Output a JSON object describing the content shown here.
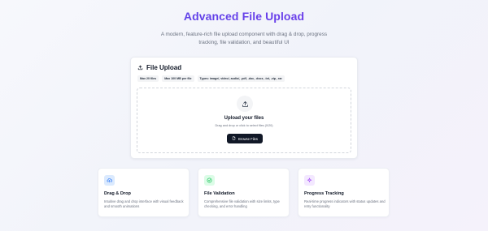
{
  "hero": {
    "title": "Advanced File Upload",
    "subtitle": "A modern, feature-rich file upload component with drag & drop, progress tracking, file validation, and beautiful UI"
  },
  "upload_card": {
    "title": "File Upload",
    "title_icon": "upload-icon",
    "badges": [
      "Max 20 files",
      "Max 100 MB per file",
      "Types: image/, video/, audio/, .pdf, .doc, .docx, .txt, .zip, .rar"
    ],
    "dropzone": {
      "icon": "upload-icon",
      "title": "Upload your files",
      "subtitle": "Drag and drop or click to select files (0/20)",
      "button_label": "Browse Files",
      "button_icon": "file-icon"
    }
  },
  "features": [
    {
      "title": "Drag & Drop",
      "description": "Intuitive drag and drop interface with visual feedback and smooth animations",
      "icon": "cloud-upload-icon",
      "color": "#3b82f6",
      "bg": "#dbeafe"
    },
    {
      "title": "File Validation",
      "description": "Comprehensive file validation with size limits, type checking, and error handling",
      "icon": "check-circle-icon",
      "color": "#22c55e",
      "bg": "#dcfce7"
    },
    {
      "title": "Progress Tracking",
      "description": "Real-time progress indicators with status updates and retry functionality",
      "icon": "sparkle-icon",
      "color": "#a855f7",
      "bg": "#f3e8ff"
    }
  ],
  "colors": {
    "accent": "#4f46e5",
    "accent2": "#7c3aed",
    "button": "#111827"
  }
}
